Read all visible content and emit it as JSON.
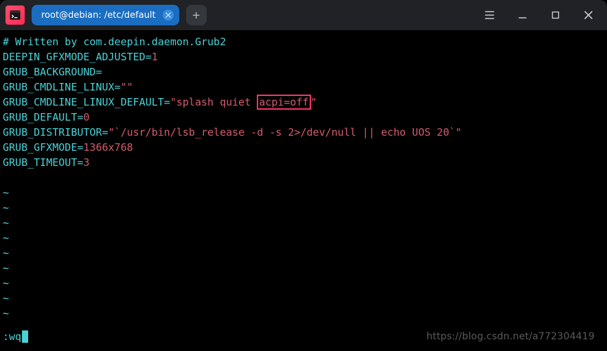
{
  "titlebar": {
    "tab_title": "root@debian: /etc/default",
    "app_icon_name": "terminal-icon",
    "new_tab_symbol": "+",
    "close_symbol": "×",
    "menu_icon": "menu-icon",
    "minimize_icon": "minimize-icon",
    "maximize_icon": "maximize-icon",
    "window_close_icon": "close-icon"
  },
  "file": {
    "comment": "# Written by com.deepin.daemon.Grub2",
    "lines": {
      "l1_key": "DEEPIN_GFXMODE_ADJUSTED=",
      "l1_val": "1",
      "l2": "GRUB_BACKGROUND=",
      "l3_key": "GRUB_CMDLINE_LINUX=",
      "l3_val": "\"\"",
      "l4_key": "GRUB_CMDLINE_LINUX_DEFAULT=",
      "l4_q1": "\"splash quiet ",
      "l4_hl": "acpi=off",
      "l4_q2": "\"",
      "l5_key": "GRUB_DEFAULT=",
      "l5_val": "0",
      "l6_key": "GRUB_DISTRIBUTOR=",
      "l6_val": "\"`/usr/bin/lsb_release -d -s 2>/dev/null || echo UOS 20`\"",
      "l7_key": "GRUB_GFXMODE=",
      "l7_val": "1366x768",
      "l8_key": "GRUB_TIMEOUT=",
      "l8_val": "3"
    }
  },
  "tilde": "~",
  "vi_command": ":wq",
  "watermark": "https://blog.csdn.net/a772304419"
}
